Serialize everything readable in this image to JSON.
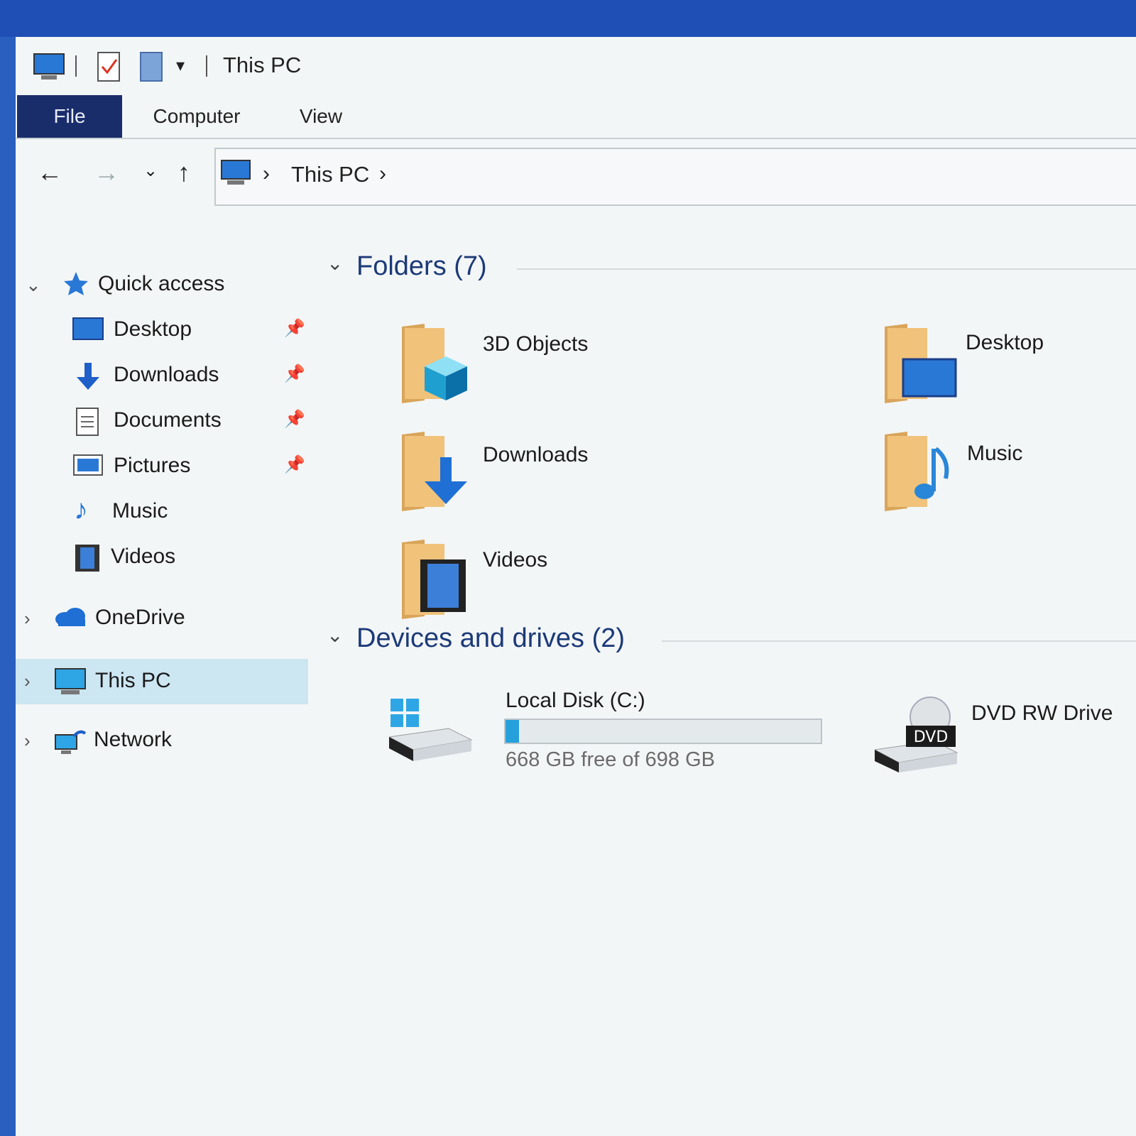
{
  "window": {
    "title": "This PC"
  },
  "ribbon": {
    "tabs": [
      "File",
      "Computer",
      "View"
    ]
  },
  "address": {
    "location": "This PC"
  },
  "sidebar": {
    "quick_access": "Quick access",
    "quick_items": [
      "Desktop",
      "Downloads",
      "Documents",
      "Pictures",
      "Music",
      "Videos"
    ],
    "onedrive": "OneDrive",
    "this_pc": "This PC",
    "network": "Network"
  },
  "folders": {
    "heading": "Folders (7)",
    "items": [
      "3D Objects",
      "Desktop",
      "Downloads",
      "Music",
      "Videos"
    ]
  },
  "devices": {
    "heading": "Devices and drives (2)",
    "local_disk": {
      "label": "Local Disk (C:)",
      "free_text": "668 GB free of 698 GB",
      "used_fraction": 0.043
    },
    "dvd": {
      "label": "DVD RW Drive",
      "badge": "DVD"
    }
  },
  "colors": {
    "accent": "#1a2d6b",
    "selection": "#cce6f2",
    "folder": "#e8b86a",
    "drive_fill": "#26a0da"
  }
}
